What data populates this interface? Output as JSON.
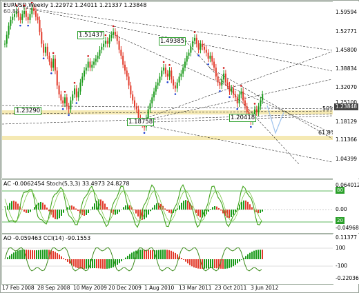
{
  "price_panel": {
    "symbol_line": "EURUSD,Weekly  1.22972 1.24011 1.21337 1.23848",
    "level_label_top": "60.85",
    "price_axis": [
      "1.59594",
      "1.52771",
      "1.45800",
      "1.38834",
      "1.32070",
      "1.25100",
      "1.18129",
      "1.11366",
      "1.04399"
    ],
    "current_price": "1.23848",
    "fib_50_label": "50%",
    "fib_618_label": "61.8%",
    "annotations": [
      "1.51437",
      "1.49385",
      "1.23290",
      "1.18758",
      "1.20418"
    ],
    "closes": [
      1.47,
      1.5,
      1.53,
      1.55,
      1.56,
      1.57,
      1.58,
      1.56,
      1.55,
      1.57,
      1.58,
      1.56,
      1.55,
      1.57,
      1.59,
      1.58,
      1.56,
      1.55,
      1.51,
      1.47,
      1.44,
      1.46,
      1.43,
      1.41,
      1.39,
      1.42,
      1.38,
      1.33,
      1.3,
      1.28,
      1.27,
      1.29,
      1.26,
      1.25,
      1.28,
      1.3,
      1.32,
      1.29,
      1.31,
      1.34,
      1.36,
      1.38,
      1.39,
      1.41,
      1.39,
      1.4,
      1.41,
      1.42,
      1.43,
      1.45,
      1.46,
      1.47,
      1.48,
      1.47,
      1.49,
      1.5,
      1.51,
      1.5,
      1.48,
      1.45,
      1.43,
      1.4,
      1.38,
      1.36,
      1.33,
      1.3,
      1.28,
      1.26,
      1.25,
      1.22,
      1.21,
      1.2,
      1.19,
      1.22,
      1.25,
      1.27,
      1.29,
      1.31,
      1.33,
      1.34,
      1.36,
      1.38,
      1.39,
      1.37,
      1.36,
      1.38,
      1.35,
      1.33,
      1.32,
      1.34,
      1.36,
      1.37,
      1.39,
      1.41,
      1.43,
      1.44,
      1.46,
      1.48,
      1.49,
      1.47,
      1.45,
      1.47,
      1.46,
      1.45,
      1.44,
      1.42,
      1.43,
      1.41,
      1.39,
      1.36,
      1.34,
      1.33,
      1.35,
      1.37,
      1.34,
      1.33,
      1.31,
      1.32,
      1.3,
      1.29,
      1.27,
      1.3,
      1.31,
      1.28,
      1.26,
      1.24,
      1.22,
      1.21,
      1.23,
      1.25,
      1.24,
      1.26,
      1.28,
      1.3
    ]
  },
  "ac_panel": {
    "label": "AC -0.0062454  Stoch(5,3,3) 33.4973 24.8278",
    "axis": [
      "0.064012",
      "0.00",
      "-0.04968"
    ],
    "stoch_levels": [
      "80",
      "20"
    ]
  },
  "ao_panel": {
    "label": "AO -0.059463  CCI(14) -90.1553",
    "axis": [
      "0.11377",
      "100",
      "-100",
      "-0.22036"
    ]
  },
  "time_axis": [
    "17 Feb 2008",
    "28 Sep 2008",
    "10 May 2009",
    "20 Dec 2009",
    "1 Aug 2010",
    "13 Mar 2011",
    "23 Oct 2011",
    "3 Jun 2012"
  ],
  "colors": {
    "up": "#1a9a1a",
    "down": "#e23a2a",
    "fractal_up": "#d01818",
    "fractal_down": "#2040d0",
    "level_band": "#f2e29a",
    "stoch": "#3fa31a",
    "cci": "#3a8a1a",
    "border": "#2aa02a"
  }
}
